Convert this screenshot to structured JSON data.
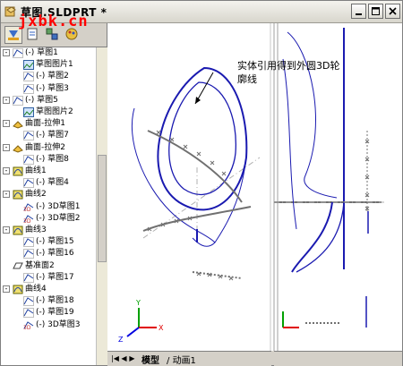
{
  "window": {
    "title": "草图.SLDPRT *",
    "watermark": "jxbk.cn",
    "controls": [
      "minimize",
      "maximize",
      "close"
    ]
  },
  "annotation": {
    "line1": "实体引用得到外圆3D轮",
    "line2": "廓线"
  },
  "tree": {
    "items": [
      {
        "label": "(-) 草图1",
        "icon": "sketch-icon",
        "expand": "-"
      },
      {
        "label": "草图图片1",
        "icon": "sketch-picture-icon",
        "expand": ""
      },
      {
        "label": "(-) 草图2",
        "icon": "sketch-icon",
        "expand": ""
      },
      {
        "label": "(-) 草图3",
        "icon": "sketch-icon",
        "expand": ""
      },
      {
        "label": "(-) 草图5",
        "icon": "sketch-icon",
        "expand": "-"
      },
      {
        "label": "草图图片2",
        "icon": "sketch-picture-icon",
        "expand": ""
      },
      {
        "label": "曲面-拉伸1",
        "icon": "surface-extrude-icon",
        "expand": "-"
      },
      {
        "label": "(-) 草图7",
        "icon": "sketch-icon",
        "expand": ""
      },
      {
        "label": "曲面-拉伸2",
        "icon": "surface-extrude-icon",
        "expand": "-"
      },
      {
        "label": "(-) 草图8",
        "icon": "sketch-icon",
        "expand": ""
      },
      {
        "label": "曲线1",
        "icon": "curve-icon",
        "expand": "-"
      },
      {
        "label": "(-) 草图4",
        "icon": "sketch-icon",
        "expand": ""
      },
      {
        "label": "曲线2",
        "icon": "curve-icon",
        "expand": "-"
      },
      {
        "label": "(-) 3D草图1",
        "icon": "sketch-3d-icon",
        "expand": ""
      },
      {
        "label": "(-) 3D草图2",
        "icon": "sketch-3d-icon",
        "expand": ""
      },
      {
        "label": "曲线3",
        "icon": "curve-icon",
        "expand": "-"
      },
      {
        "label": "(-) 草图15",
        "icon": "sketch-icon",
        "expand": ""
      },
      {
        "label": "(-) 草图16",
        "icon": "sketch-icon",
        "expand": ""
      },
      {
        "label": "基准面2",
        "icon": "plane-icon",
        "expand": ""
      },
      {
        "label": "(-) 草图17",
        "icon": "sketch-icon",
        "expand": ""
      },
      {
        "label": "曲线4",
        "icon": "curve-icon",
        "expand": "-"
      },
      {
        "label": "(-) 草图18",
        "icon": "sketch-icon",
        "expand": ""
      },
      {
        "label": "(-) 草图19",
        "icon": "sketch-icon",
        "expand": ""
      },
      {
        "label": "(-) 3D草图3",
        "icon": "sketch-3d-icon",
        "expand": ""
      }
    ]
  },
  "bottom_tabs": {
    "model": "模型",
    "animation": "动画1"
  },
  "axes": {
    "x": "X",
    "y": "Y",
    "z": "Z"
  },
  "colors": {
    "curve_blue": "#1a1ab0",
    "sketch_gray": "#707070",
    "axis_red": "#e00000",
    "axis_green": "#00a000",
    "axis_blue": "#0000e0"
  }
}
